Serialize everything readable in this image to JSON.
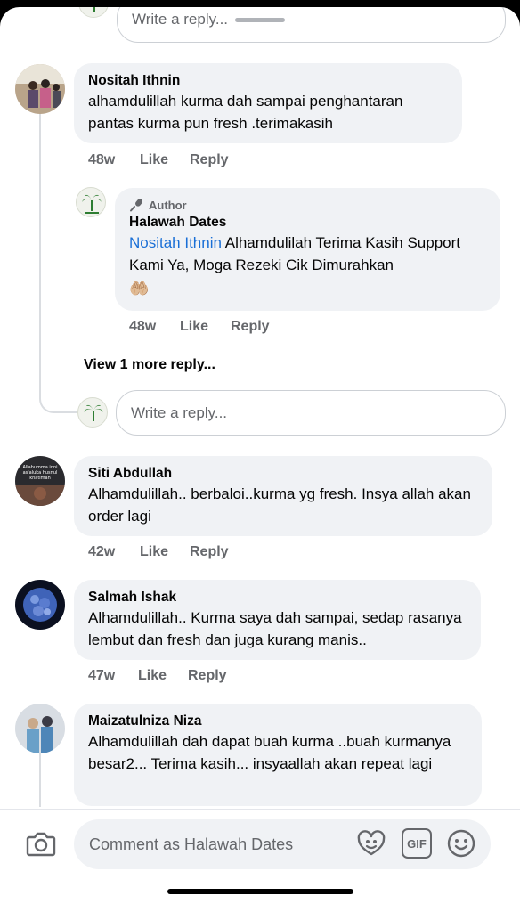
{
  "top_reply_box": {
    "placeholder": "Write a reply..."
  },
  "comments": [
    {
      "author": "Nositah Ithnin",
      "text": "alhamdulillah kurma dah sampai  penghantaran pantas kurma pun fresh .terimakasih",
      "time": "48w",
      "like": "Like",
      "reply": "Reply",
      "author_reply": {
        "badge": "Author",
        "author": "Halawah Dates",
        "mention": "Nositah Ithnin",
        "text": " Alhamdulilah Terima Kasih Support Kami Ya, Moga Rezeki Cik Dimurahkan",
        "emoji": "🤲🏼",
        "time": "48w",
        "like": "Like",
        "reply": "Reply"
      },
      "view_more": "View 1 more reply...",
      "reply_placeholder": "Write a reply..."
    },
    {
      "author": "Siti Abdullah",
      "avatar_caption": "Allahumma inni as'aluka husnul khatimah",
      "text": "Alhamdulillah.. berbaloi..kurma yg fresh. Insya allah akan order lagi",
      "time": "42w",
      "like": "Like",
      "reply": "Reply"
    },
    {
      "author": "Salmah Ishak",
      "text": "Alhamdulillah.. Kurma saya dah sampai, sedap rasanya lembut dan fresh dan juga kurang manis..",
      "time": "47w",
      "like": "Like",
      "reply": "Reply"
    },
    {
      "author": "Maizatulniza Niza",
      "text": "Alhamdulillah dah dapat  buah kurma ..buah kurmanya besar2... Terima kasih... insyaallah akan repeat lagi"
    }
  ],
  "composer": {
    "placeholder": "Comment as Halawah Dates",
    "icons": [
      "camera-icon",
      "avatar-sticker-icon",
      "gif-icon",
      "emoji-icon"
    ],
    "gif_label": "GIF"
  },
  "colors": {
    "accent": "#1a6fd6",
    "bubble": "#f0f2f5",
    "meta": "#65676b"
  }
}
